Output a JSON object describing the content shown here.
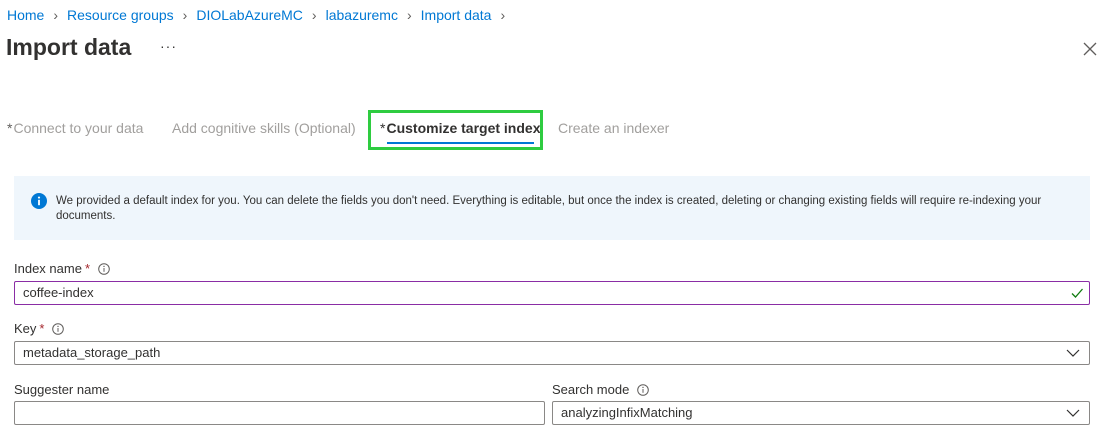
{
  "breadcrumb": [
    {
      "label": "Home"
    },
    {
      "label": "Resource groups"
    },
    {
      "label": "DIOLabAzureMC"
    },
    {
      "label": "labazuremc"
    },
    {
      "label": "Import data"
    }
  ],
  "page": {
    "title": "Import data",
    "more_label": "···"
  },
  "tabs": [
    {
      "required": "*",
      "label": "Connect to your data"
    },
    {
      "required": "",
      "label": "Add cognitive skills (Optional)"
    },
    {
      "required": "*",
      "label": "Customize target index"
    },
    {
      "required": "",
      "label": "Create an indexer"
    }
  ],
  "active_tab": "Customize target index",
  "info": {
    "text": "We provided a default index for you. You can delete the fields you don't need. Everything is editable, but once the index is created, deleting or changing existing fields will require re-indexing your documents."
  },
  "form": {
    "index_name": {
      "label": "Index name",
      "required": "*",
      "value": "coffee-index"
    },
    "key": {
      "label": "Key",
      "required": "*",
      "value": "metadata_storage_path"
    },
    "suggester_name": {
      "label": "Suggester name",
      "value": ""
    },
    "search_mode": {
      "label": "Search mode",
      "value": "analyzingInfixMatching"
    }
  },
  "colors": {
    "link": "#0078d4",
    "highlight": "#2ecc40",
    "info_bg": "#eff6fc",
    "focus_border": "#8a2da5",
    "success": "#107c10"
  }
}
